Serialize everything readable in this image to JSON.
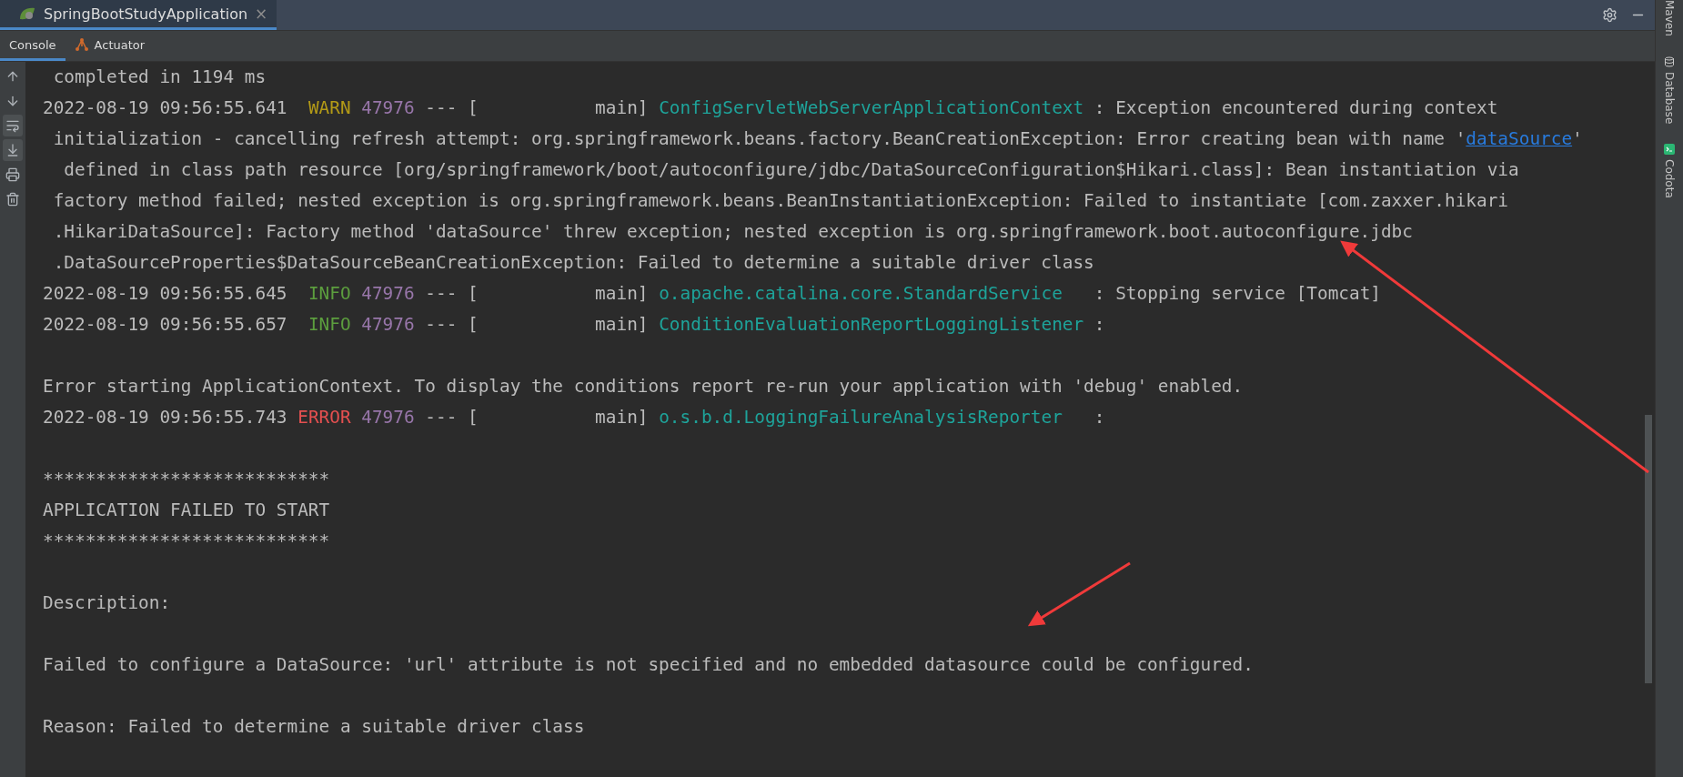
{
  "run_tabs": [
    {
      "label": "SpringBootStudyApplication",
      "selected": true,
      "close": "×"
    }
  ],
  "tool_tabs": [
    {
      "label": "Console",
      "selected": true,
      "kind": "plain"
    },
    {
      "label": "Actuator",
      "selected": false,
      "kind": "network"
    }
  ],
  "side_tools": [
    {
      "label": "Maven",
      "kind": "plain"
    },
    {
      "label": "Database",
      "kind": "database"
    },
    {
      "label": "Codota",
      "kind": "terminal"
    }
  ],
  "console_actions": [
    {
      "kind": "up",
      "selected": false
    },
    {
      "kind": "down",
      "selected": false
    },
    {
      "kind": "wrap",
      "selected": true
    },
    {
      "kind": "scroll_end",
      "selected": true
    },
    {
      "kind": "print",
      "selected": false
    },
    {
      "kind": "clear",
      "selected": false
    }
  ],
  "lines": [
    {
      "kind": "text",
      "text": " completed in 1194 ms"
    },
    {
      "kind": "log",
      "timestamp": "2022-08-19 09:56:55.641",
      "level": " WARN",
      "color": "#b39a17",
      "pid": "47976",
      "sep": "--- [",
      "thread": "           main]",
      "logger": "ConfigServletWebServerApplicationContext",
      "message": " : Exception encountered during context"
    },
    {
      "kind": "link",
      "before": " initialization - cancelling refresh attempt: org.springframework.beans.factory.BeanCreationException: Error creating bean with name '",
      "link": "dataSource",
      "after": "'"
    },
    {
      "kind": "text",
      "text": "  defined in class path resource [org/springframework/boot/autoconfigure/jdbc/DataSourceConfiguration$Hikari.class]: Bean instantiation via"
    },
    {
      "kind": "text",
      "text": " factory method failed; nested exception is org.springframework.beans.BeanInstantiationException: Failed to instantiate [com.zaxxer.hikari"
    },
    {
      "kind": "text",
      "text": " .HikariDataSource]: Factory method 'dataSource' threw exception; nested exception is org.springframework.boot.autoconfigure.jdbc"
    },
    {
      "kind": "text",
      "text": " .DataSourceProperties$DataSourceBeanCreationException: Failed to determine a suitable driver class"
    },
    {
      "kind": "log",
      "timestamp": "2022-08-19 09:56:55.645",
      "level": " INFO",
      "color": "#5c9e3e",
      "pid": "47976",
      "sep": "--- [",
      "thread": "           main]",
      "logger": "o.apache.catalina.core.StandardService  ",
      "message": " : Stopping service [Tomcat]"
    },
    {
      "kind": "log",
      "timestamp": "2022-08-19 09:56:55.657",
      "level": " INFO",
      "color": "#5c9e3e",
      "pid": "47976",
      "sep": "--- [",
      "thread": "           main]",
      "logger": "ConditionEvaluationReportLoggingListener",
      "message": " :"
    },
    {
      "kind": "blank"
    },
    {
      "kind": "text",
      "text": "Error starting ApplicationContext. To display the conditions report re-run your application with 'debug' enabled."
    },
    {
      "kind": "log",
      "timestamp": "2022-08-19 09:56:55.743",
      "level": "ERROR",
      "color": "#e55050",
      "pid": "47976",
      "sep": "--- [",
      "thread": "           main]",
      "logger": "o.s.b.d.LoggingFailureAnalysisReporter  ",
      "message": " :"
    },
    {
      "kind": "blank"
    },
    {
      "kind": "text",
      "text": "***************************"
    },
    {
      "kind": "text",
      "text": "APPLICATION FAILED TO START"
    },
    {
      "kind": "text",
      "text": "***************************"
    },
    {
      "kind": "blank"
    },
    {
      "kind": "text",
      "text": "Description:"
    },
    {
      "kind": "blank"
    },
    {
      "kind": "text",
      "text": "Failed to configure a DataSource: 'url' attribute is not specified and no embedded datasource could be configured."
    },
    {
      "kind": "blank"
    },
    {
      "kind": "text",
      "text": "Reason: Failed to determine a suitable driver class"
    }
  ]
}
